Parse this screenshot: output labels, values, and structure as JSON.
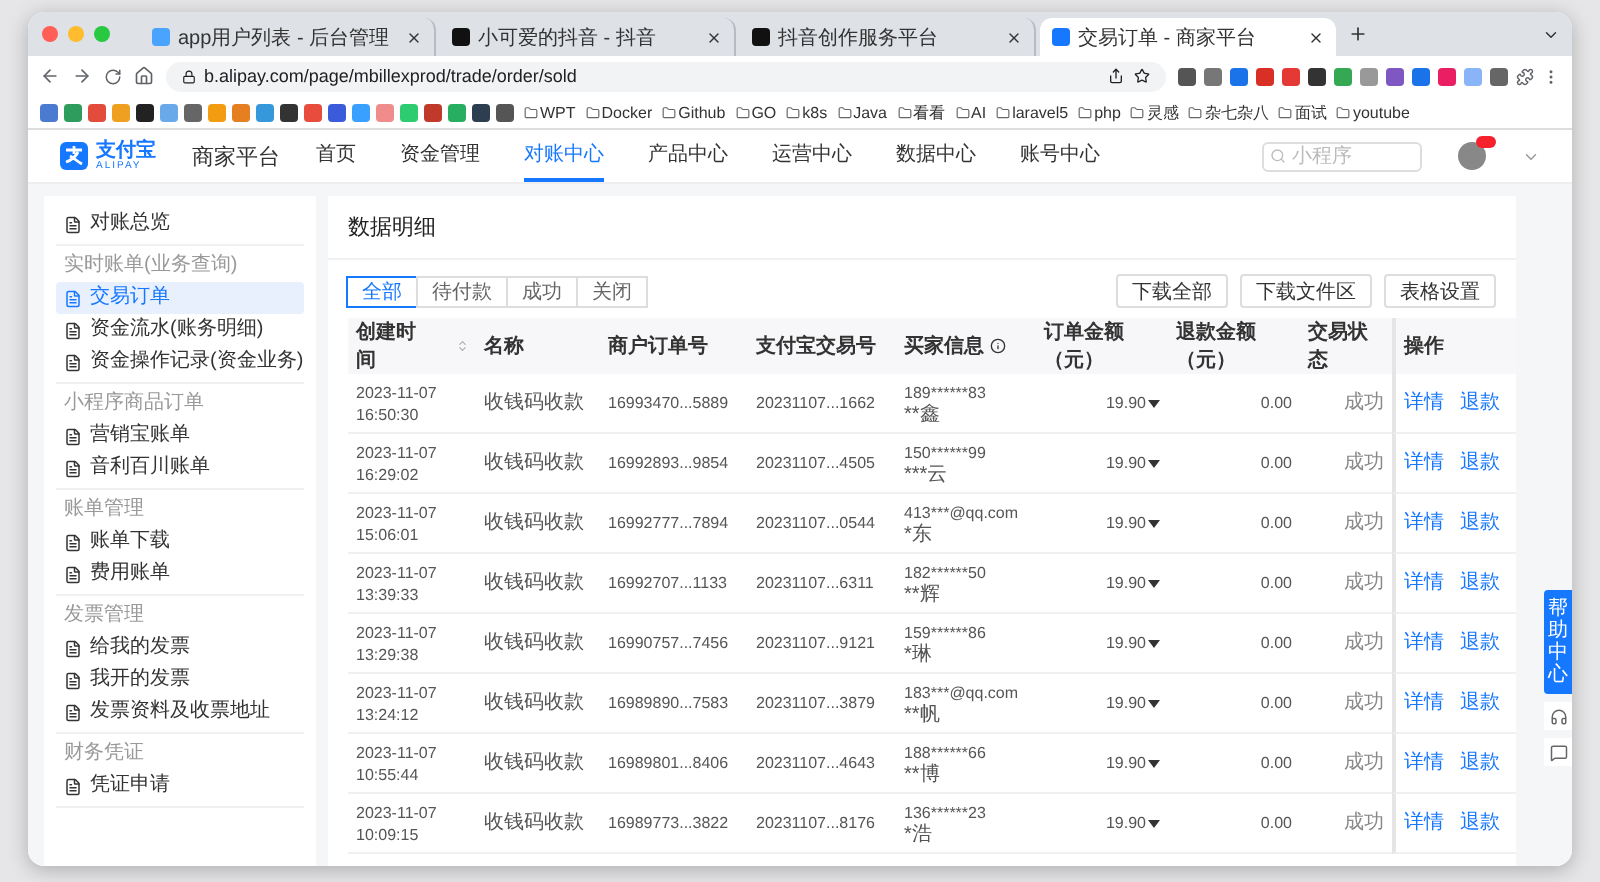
{
  "browser": {
    "tabs": [
      {
        "title": "app用户列表 - 后台管理",
        "selected": false
      },
      {
        "title": "小可爱的抖音 - 抖音",
        "selected": false
      },
      {
        "title": "抖音创作服务平台",
        "selected": false
      },
      {
        "title": "交易订单 - 商家平台",
        "selected": true
      }
    ],
    "url": "b.alipay.com/page/mbillexprod/trade/order/sold",
    "bookmark_folders": [
      "WPT",
      "Docker",
      "Github",
      "GO",
      "k8s",
      "Java",
      "看看",
      "AI",
      "laravel5",
      "php",
      "灵感",
      "杂七杂八",
      "面试",
      "youtube"
    ]
  },
  "header": {
    "brand": "支付宝",
    "brand_sub": "ALIPAY",
    "platform": "商家平台",
    "nav": [
      {
        "label": "首页",
        "selected": false
      },
      {
        "label": "资金管理",
        "selected": false
      },
      {
        "label": "对账中心",
        "selected": true
      },
      {
        "label": "产品中心",
        "selected": false
      },
      {
        "label": "运营中心",
        "selected": false
      },
      {
        "label": "数据中心",
        "selected": false
      },
      {
        "label": "账号中心",
        "selected": false
      }
    ],
    "search": {
      "placeholder": "小程序"
    }
  },
  "sidebar": {
    "sections": [
      {
        "items": [
          {
            "label": "对账总览",
            "selected": false
          }
        ]
      },
      {
        "title": "实时账单(业务查询)",
        "items": [
          {
            "label": "交易订单",
            "selected": true
          },
          {
            "label": "资金流水(账务明细)",
            "selected": false
          },
          {
            "label": "资金操作记录(资金业务)",
            "selected": false
          }
        ]
      },
      {
        "title": "小程序商品订单",
        "items": [
          {
            "label": "营销宝账单",
            "selected": false
          },
          {
            "label": "音利百川账单",
            "selected": false
          }
        ]
      },
      {
        "title": "账单管理",
        "items": [
          {
            "label": "账单下载",
            "selected": false
          },
          {
            "label": "费用账单",
            "selected": false
          }
        ]
      },
      {
        "title": "发票管理",
        "items": [
          {
            "label": "给我的发票",
            "selected": false
          },
          {
            "label": "我开的发票",
            "selected": false
          },
          {
            "label": "发票资料及收票地址",
            "selected": false
          }
        ]
      },
      {
        "title": "财务凭证",
        "items": [
          {
            "label": "凭证申请",
            "selected": false
          }
        ]
      }
    ]
  },
  "main": {
    "title": "数据明细",
    "filters": [
      {
        "label": "全部",
        "selected": true
      },
      {
        "label": "待付款",
        "selected": false
      },
      {
        "label": "成功",
        "selected": false
      },
      {
        "label": "关闭",
        "selected": false
      }
    ],
    "buttons": [
      "下载全部",
      "下载文件区",
      "表格设置"
    ],
    "table": {
      "columns": [
        "创建时间",
        "名称",
        "商户订单号",
        "支付宝交易号",
        "买家信息",
        "订单金额（元）",
        "退款金额（元）",
        "交易状态",
        "操作"
      ],
      "rows": [
        {
          "date": "2023-11-07",
          "time": "16:50:30",
          "name": "收钱码收款",
          "merchant_no": "16993470...5889",
          "trade_no": "20231107...1662",
          "buyer_contact": "189******83",
          "buyer_name": "**鑫",
          "amount": "19.90",
          "refund": "0.00",
          "status": "成功",
          "actions": [
            "详情",
            "退款"
          ]
        },
        {
          "date": "2023-11-07",
          "time": "16:29:02",
          "name": "收钱码收款",
          "merchant_no": "16992893...9854",
          "trade_no": "20231107...4505",
          "buyer_contact": "150******99",
          "buyer_name": "***云",
          "amount": "19.90",
          "refund": "0.00",
          "status": "成功",
          "actions": [
            "详情",
            "退款"
          ]
        },
        {
          "date": "2023-11-07",
          "time": "15:06:01",
          "name": "收钱码收款",
          "merchant_no": "16992777...7894",
          "trade_no": "20231107...0544",
          "buyer_contact": "413***@qq.com",
          "buyer_name": "*东",
          "amount": "19.90",
          "refund": "0.00",
          "status": "成功",
          "actions": [
            "详情",
            "退款"
          ]
        },
        {
          "date": "2023-11-07",
          "time": "13:39:33",
          "name": "收钱码收款",
          "merchant_no": "16992707...1133",
          "trade_no": "20231107...6311",
          "buyer_contact": "182******50",
          "buyer_name": "**辉",
          "amount": "19.90",
          "refund": "0.00",
          "status": "成功",
          "actions": [
            "详情",
            "退款"
          ]
        },
        {
          "date": "2023-11-07",
          "time": "13:29:38",
          "name": "收钱码收款",
          "merchant_no": "16990757...7456",
          "trade_no": "20231107...9121",
          "buyer_contact": "159******86",
          "buyer_name": "*琳",
          "amount": "19.90",
          "refund": "0.00",
          "status": "成功",
          "actions": [
            "详情",
            "退款"
          ]
        },
        {
          "date": "2023-11-07",
          "time": "13:24:12",
          "name": "收钱码收款",
          "merchant_no": "16989890...7583",
          "trade_no": "20231107...3879",
          "buyer_contact": "183***@qq.com",
          "buyer_name": "**帆",
          "amount": "19.90",
          "refund": "0.00",
          "status": "成功",
          "actions": [
            "详情",
            "退款"
          ]
        },
        {
          "date": "2023-11-07",
          "time": "10:55:44",
          "name": "收钱码收款",
          "merchant_no": "16989801...8406",
          "trade_no": "20231107...4643",
          "buyer_contact": "188******66",
          "buyer_name": "**博",
          "amount": "19.90",
          "refund": "0.00",
          "status": "成功",
          "actions": [
            "详情",
            "退款"
          ]
        },
        {
          "date": "2023-11-07",
          "time": "10:09:15",
          "name": "收钱码收款",
          "merchant_no": "16989773...3822",
          "trade_no": "20231107...8176",
          "buyer_contact": "136******23",
          "buyer_name": "*浩",
          "amount": "19.90",
          "refund": "0.00",
          "status": "成功",
          "actions": [
            "详情",
            "退款"
          ]
        }
      ]
    }
  },
  "help": {
    "label": "帮助中心"
  }
}
